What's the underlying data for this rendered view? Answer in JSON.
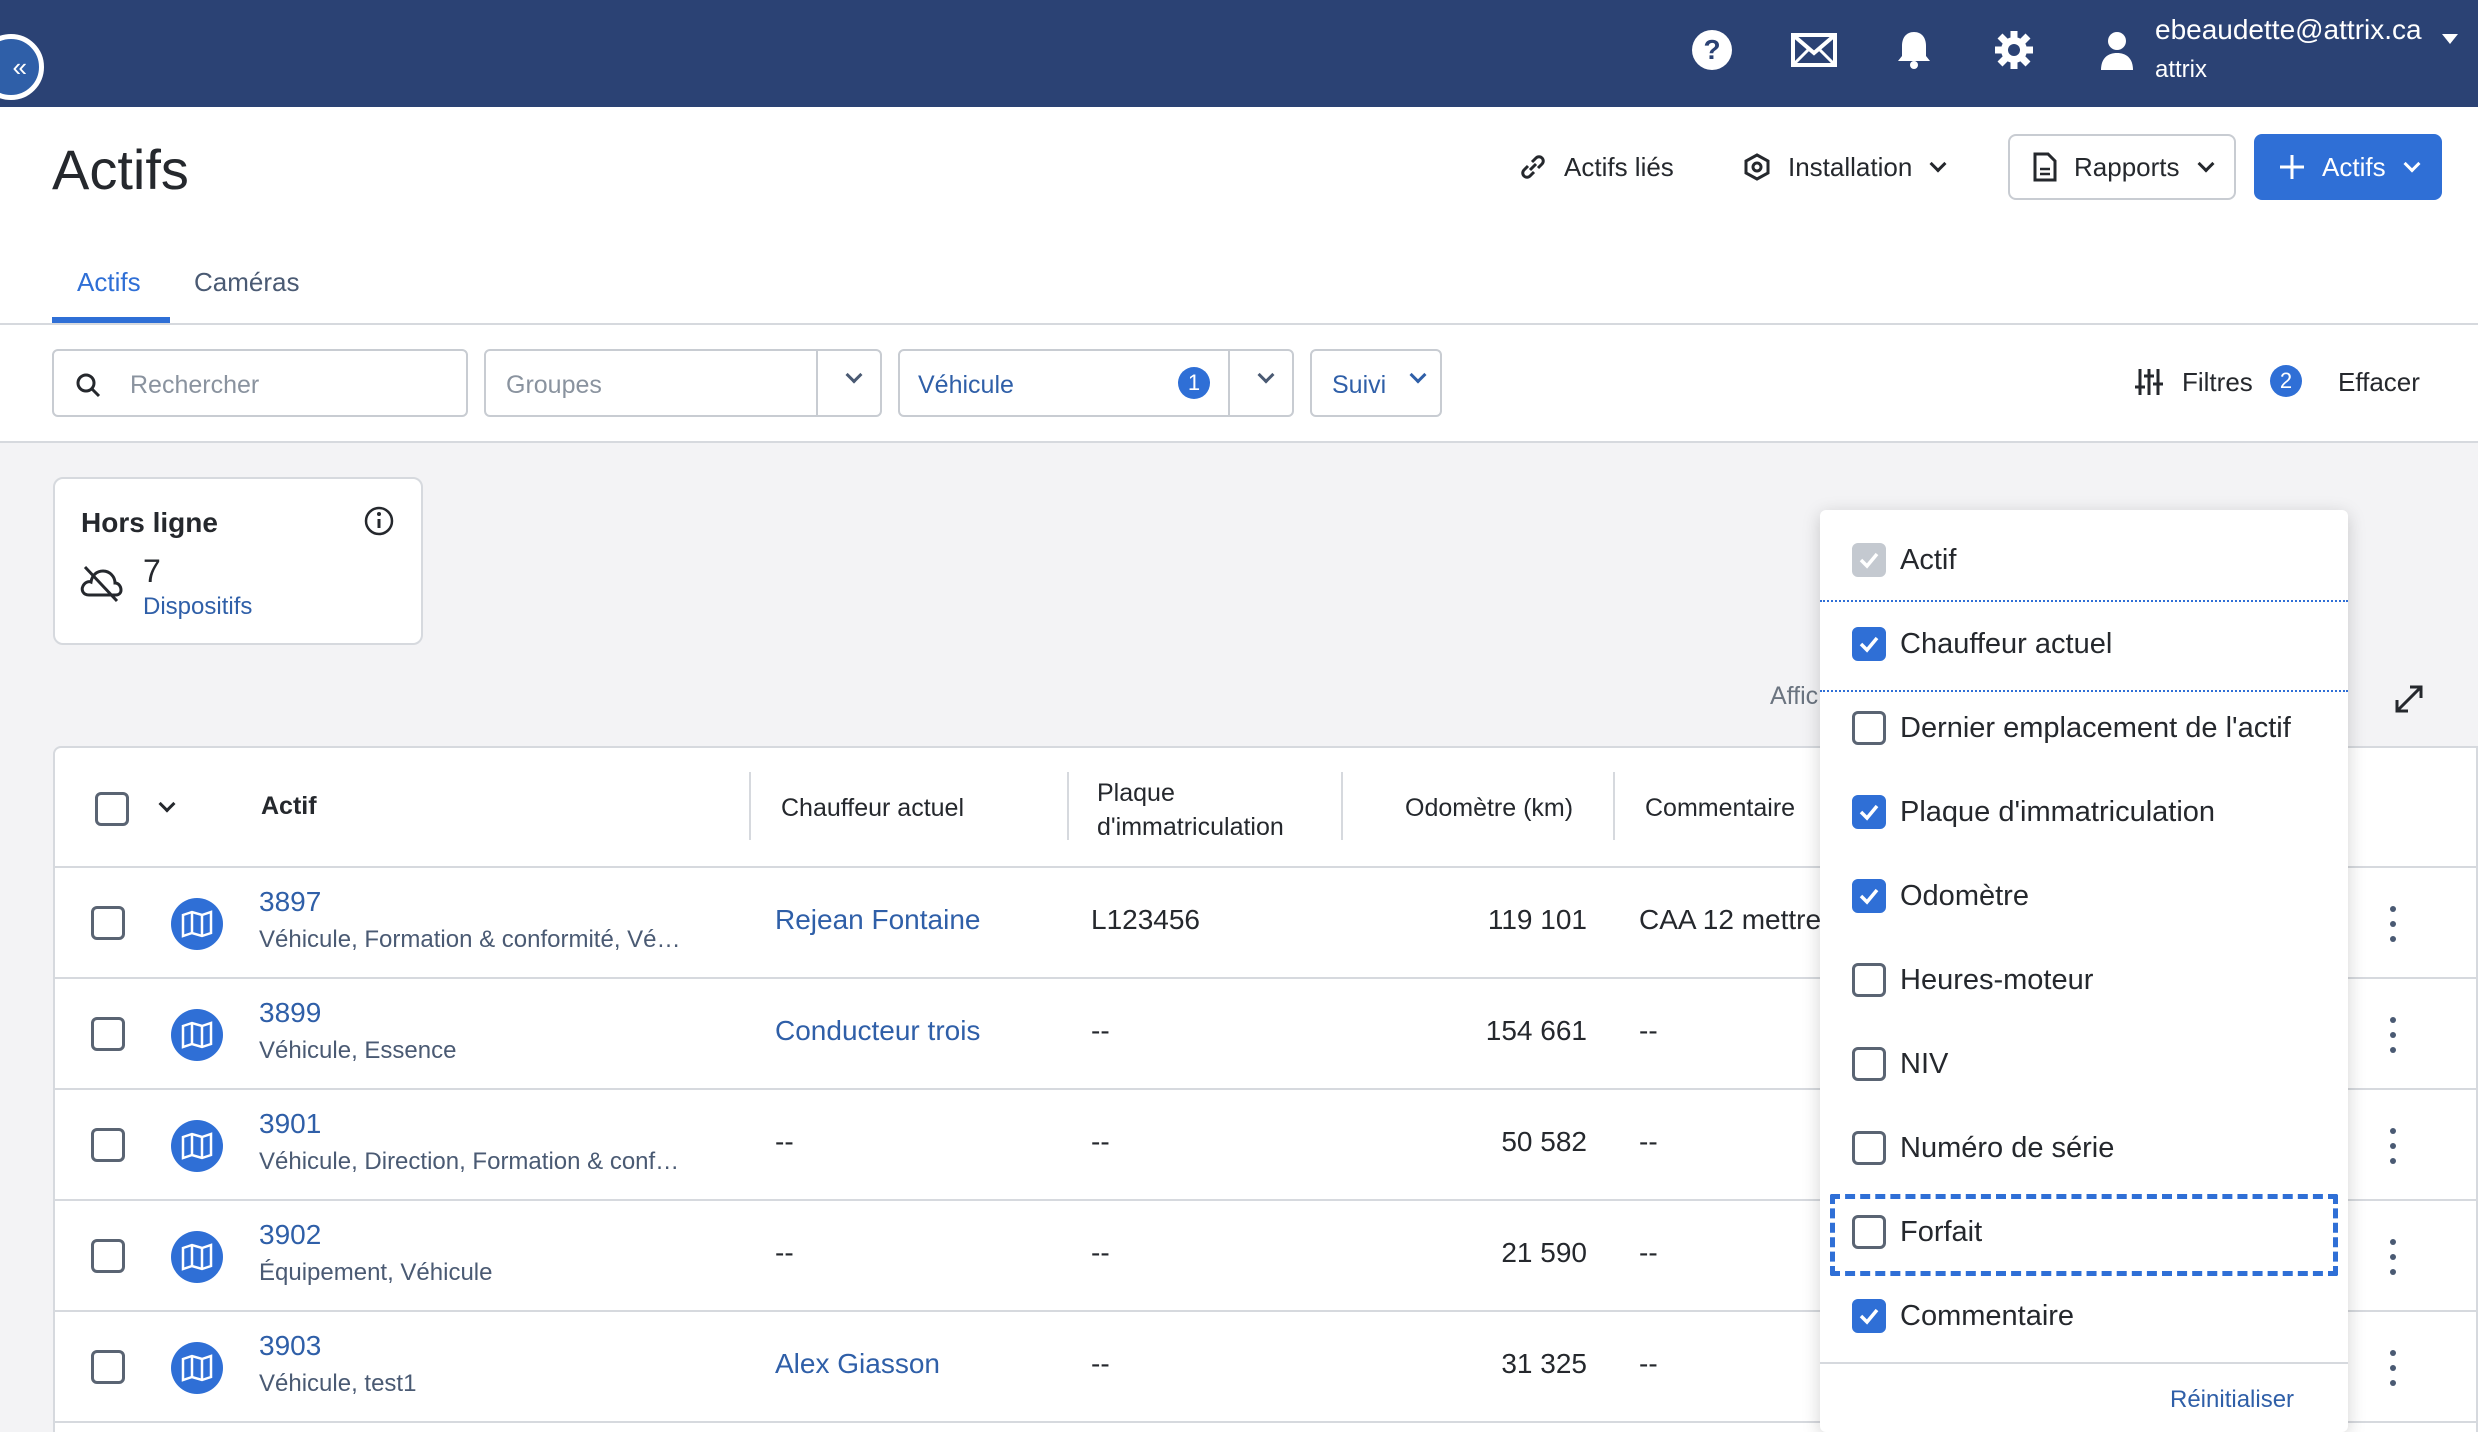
{
  "topbar": {
    "user_email": "ebeaudette@attrix.ca",
    "user_org": "attrix",
    "icons": [
      "help-icon",
      "mail-icon",
      "bell-icon",
      "gear-icon",
      "user-icon"
    ]
  },
  "header": {
    "title": "Actifs",
    "linked_assets_label": "Actifs liés",
    "installation_label": "Installation",
    "reports_label": "Rapports",
    "add_assets_label": "Actifs"
  },
  "tabs": [
    {
      "label": "Actifs",
      "active": true
    },
    {
      "label": "Caméras",
      "active": false
    }
  ],
  "filters": {
    "search_placeholder": "Rechercher",
    "groups_placeholder": "Groupes",
    "vehicle_label": "Véhicule",
    "vehicle_count": "1",
    "tracking_label": "Suivi",
    "filters_label": "Filtres",
    "filters_count": "2",
    "clear_label": "Effacer"
  },
  "summary_card": {
    "title": "Hors ligne",
    "count": "7",
    "unit": "Dispositifs"
  },
  "partial_label": "Affic",
  "table": {
    "columns": [
      "Actif",
      "Chauffeur actuel",
      "Plaque d'immatriculation",
      "Odomètre (km)",
      "Commentaire"
    ],
    "rows": [
      {
        "id": "3897",
        "groups": "Véhicule, Formation & conformité, Vé…",
        "driver": "Rejean Fontaine",
        "plate": "L123456",
        "odometer": "119 101",
        "comment": "CAA 12 mettre"
      },
      {
        "id": "3899",
        "groups": "Véhicule, Essence",
        "driver": "Conducteur trois",
        "plate": "--",
        "odometer": "154 661",
        "comment": "--"
      },
      {
        "id": "3901",
        "groups": "Véhicule, Direction, Formation & conf…",
        "driver": "--",
        "plate": "--",
        "odometer": "50 582",
        "comment": "--"
      },
      {
        "id": "3902",
        "groups": "Équipement, Véhicule",
        "driver": "--",
        "plate": "--",
        "odometer": "21 590",
        "comment": "--"
      },
      {
        "id": "3903",
        "groups": "Véhicule, test1",
        "driver": "Alex Giasson",
        "plate": "--",
        "odometer": "31 325",
        "comment": "--"
      }
    ]
  },
  "column_chooser": {
    "options": [
      {
        "label": "Actif",
        "state": "disabled-checked"
      },
      {
        "label": "Chauffeur actuel",
        "state": "checked"
      },
      {
        "label": "Dernier emplacement de l'actif",
        "state": "unchecked"
      },
      {
        "label": "Plaque d'immatriculation",
        "state": "checked"
      },
      {
        "label": "Odomètre",
        "state": "checked"
      },
      {
        "label": "Heures-moteur",
        "state": "unchecked"
      },
      {
        "label": "NIV",
        "state": "unchecked"
      },
      {
        "label": "Numéro de série",
        "state": "unchecked"
      },
      {
        "label": "Forfait",
        "state": "unchecked"
      },
      {
        "label": "Commentaire",
        "state": "checked"
      }
    ],
    "focused": "Forfait",
    "reset_label": "Réinitialiser"
  },
  "colors": {
    "topbar": "#2b4274",
    "primary": "#2f6fd6",
    "link": "#2f5fa8"
  }
}
